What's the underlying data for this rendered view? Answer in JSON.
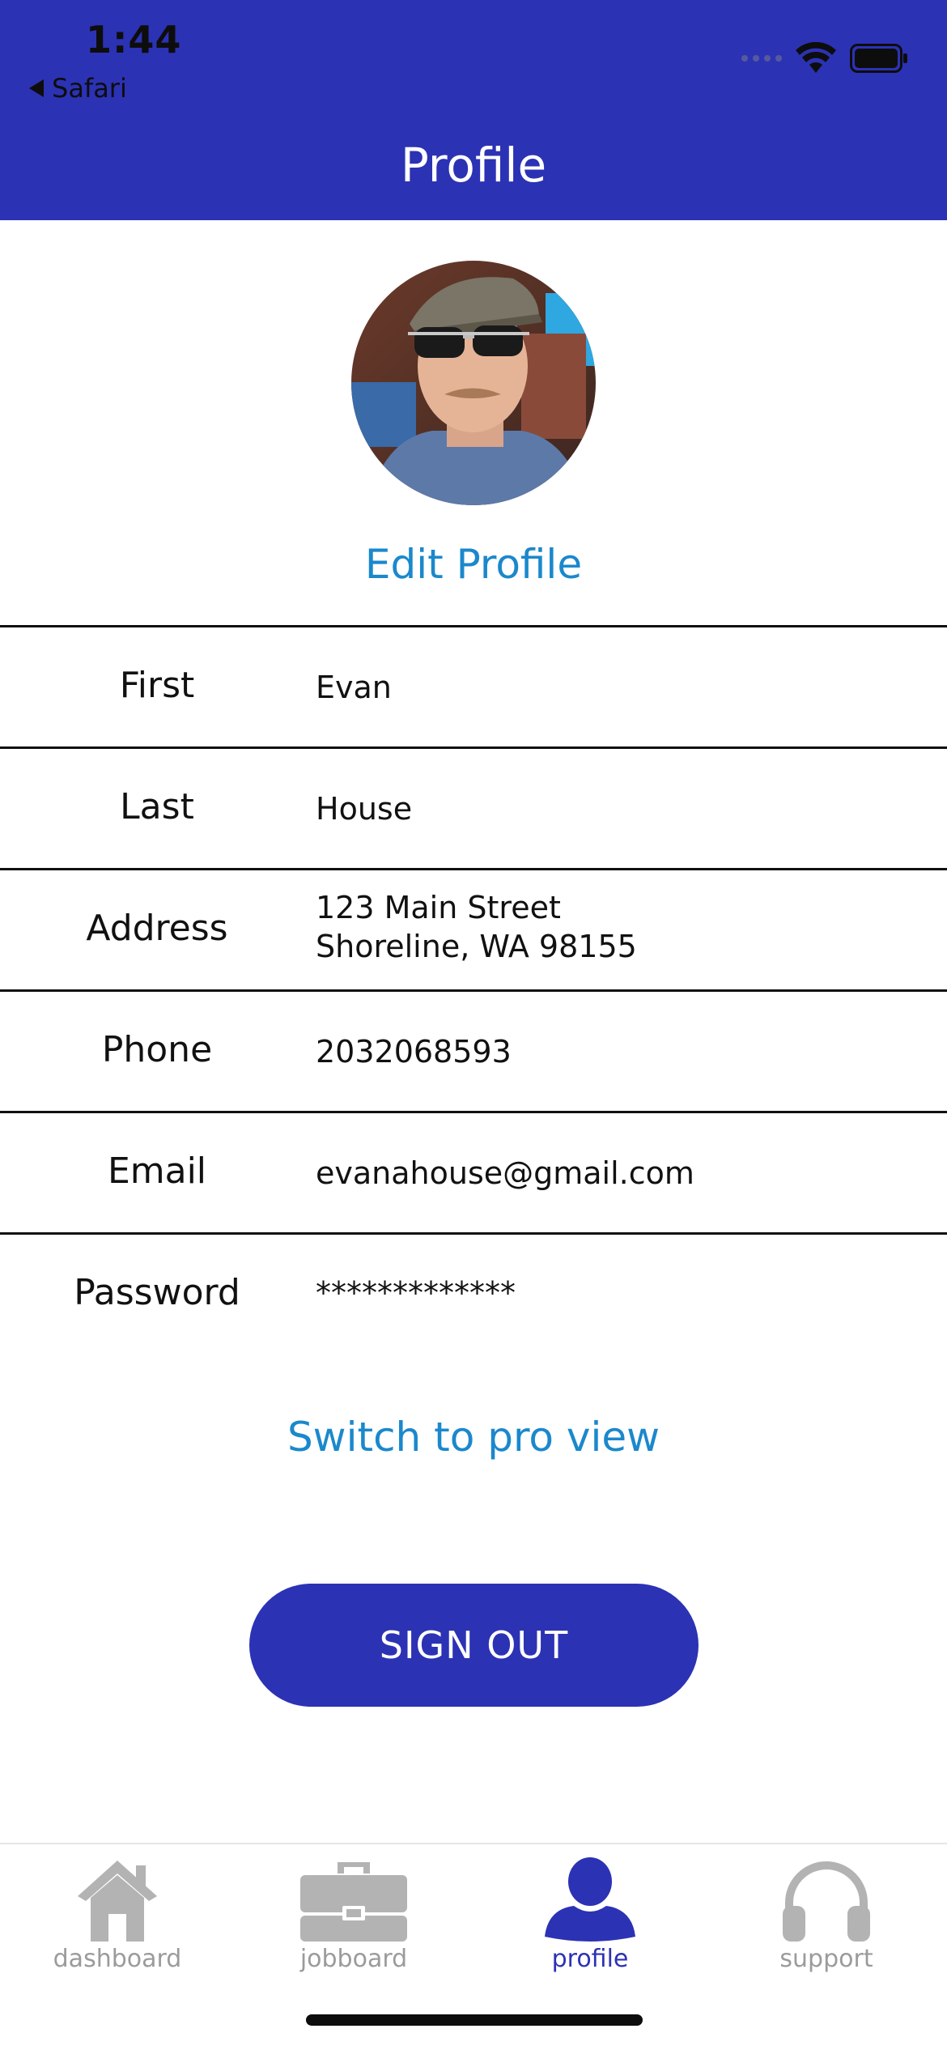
{
  "status_bar": {
    "time": "1:44",
    "back_label": "Safari"
  },
  "header": {
    "title": "Profile"
  },
  "profile": {
    "edit_label": "Edit Profile",
    "fields": [
      {
        "label": "First",
        "value": "Evan"
      },
      {
        "label": "Last",
        "value": "House"
      },
      {
        "label": "Address",
        "value_line1": "123 Main Street",
        "value_line2": "Shoreline, WA 98155"
      },
      {
        "label": "Phone",
        "value": "2032068593"
      },
      {
        "label": "Email",
        "value": "evanahouse@gmail.com"
      },
      {
        "label": "Password",
        "value": "*************"
      }
    ],
    "switch_label": "Switch to pro view",
    "signout_label": "SIGN OUT"
  },
  "tabbar": {
    "tabs": [
      {
        "label": "dashboard",
        "icon": "home-icon",
        "active": false
      },
      {
        "label": "jobboard",
        "icon": "briefcase-icon",
        "active": false
      },
      {
        "label": "profile",
        "icon": "person-icon",
        "active": true
      },
      {
        "label": "support",
        "icon": "headphones-icon",
        "active": false
      }
    ]
  },
  "colors": {
    "brand": "#2c32b4",
    "link": "#1b88cc",
    "tab_inactive": "#9b9b9b"
  }
}
